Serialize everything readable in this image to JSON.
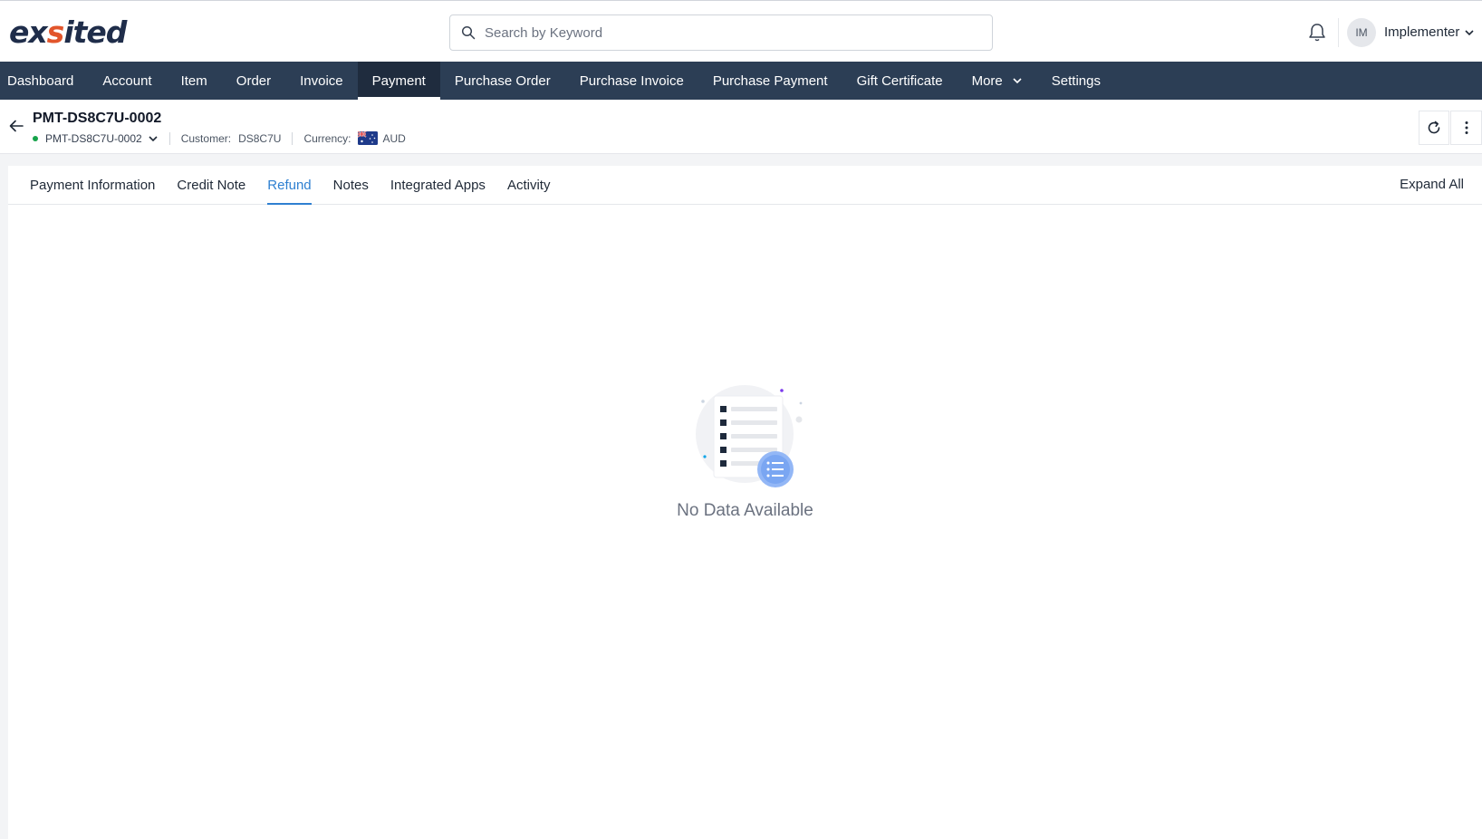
{
  "header": {
    "logo_pre": "ex",
    "logo_accent": "s",
    "logo_post": "ited",
    "search_placeholder": "Search by Keyword",
    "avatar_initials": "IM",
    "user_name": "Implementer"
  },
  "nav": {
    "items": [
      "Dashboard",
      "Account",
      "Item",
      "Order",
      "Invoice",
      "Payment",
      "Purchase Order",
      "Purchase Invoice",
      "Purchase Payment",
      "Gift Certificate",
      "More",
      "Settings"
    ],
    "active": "Payment"
  },
  "record": {
    "title": "PMT-DS8C7U-0002",
    "id_select": "PMT-DS8C7U-0002",
    "customer_label": "Customer:",
    "customer_value": "DS8C7U",
    "currency_label": "Currency:",
    "currency_value": "AUD"
  },
  "tabs": {
    "items": [
      "Payment Information",
      "Credit Note",
      "Refund",
      "Notes",
      "Integrated Apps",
      "Activity"
    ],
    "active": "Refund",
    "expand_all": "Expand All"
  },
  "empty_state": {
    "message": "No Data Available"
  },
  "colors": {
    "nav_bg": "#2c3e55",
    "accent": "#2f80d1",
    "logo_accent": "#e2552b",
    "status_dot": "#16a34a"
  }
}
